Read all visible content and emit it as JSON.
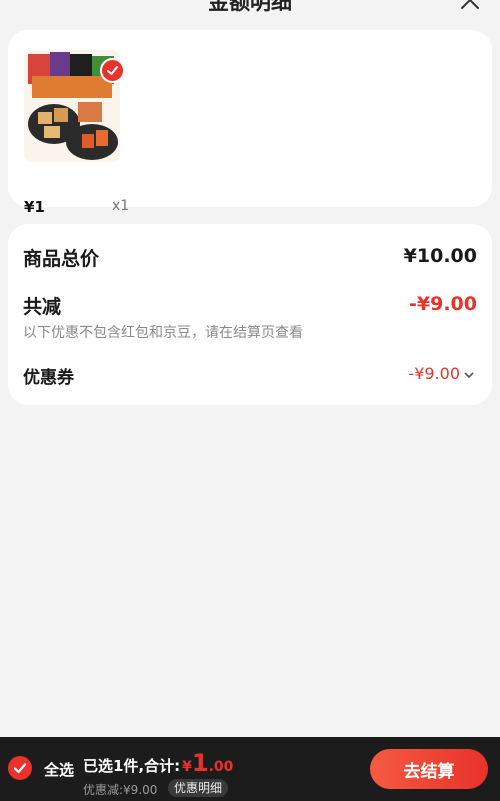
{
  "header": {
    "title": "金额明细"
  },
  "product": {
    "price": "¥1",
    "quantity": "x1"
  },
  "summary": {
    "total_label": "商品总价",
    "total_value": "¥10.00",
    "reduce_label": "共减",
    "reduce_value": "-¥9.00",
    "note": "以下优惠不包含红包和京豆，请在结算页查看",
    "coupon_label": "优惠券",
    "coupon_value": "-¥9.00"
  },
  "bottom_bar": {
    "select_all": "全选",
    "selected_text": "已选1件,合计:",
    "currency": "¥",
    "total_int": "1",
    "total_dec": ".00",
    "discount_text": "优惠减:¥9.00",
    "detail_link": "优惠明细",
    "checkout": "去结算"
  },
  "colors": {
    "accent": "#e8322b",
    "bar_bg": "#1c1c1c",
    "page_bg": "#f3f3f3"
  }
}
